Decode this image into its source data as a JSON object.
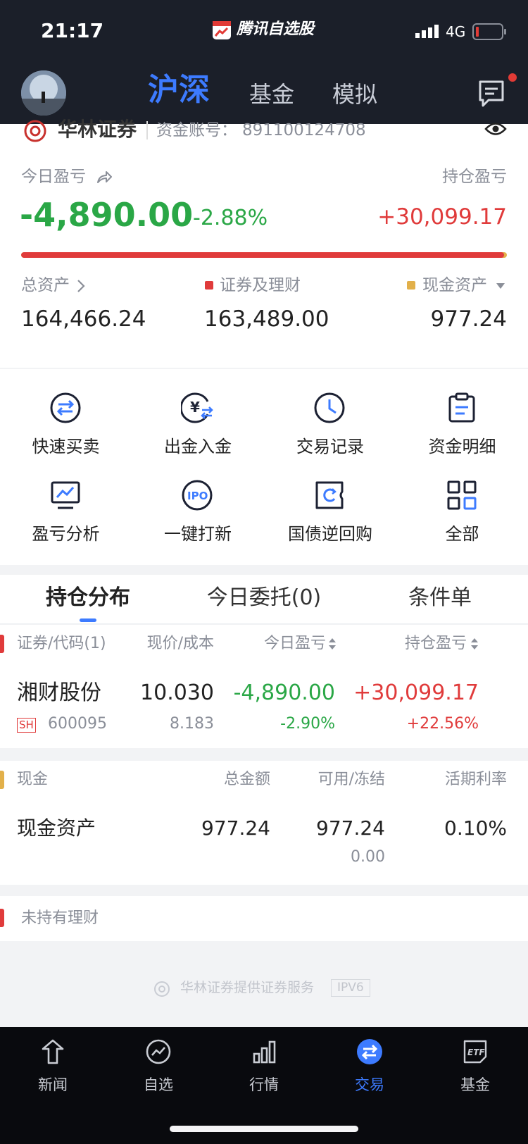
{
  "status_bar": {
    "time": "21:17",
    "app_name": "腾讯自选股",
    "network": "4G"
  },
  "nav": {
    "tabs": [
      "沪深",
      "基金",
      "模拟"
    ],
    "active_tab": 0
  },
  "account": {
    "broker": "华林证券",
    "account_label": "资金账号：",
    "account_number": "891100124708"
  },
  "summary": {
    "today_pl_label": "今日盈亏",
    "today_pl": "-4,890.00",
    "today_pl_pct": "-2.88%",
    "holding_pl_label": "持仓盈亏",
    "holding_pl": "+30,099.17",
    "securities_ratio": 0.994,
    "total_assets_label": "总资产",
    "total_assets": "164,466.24",
    "securities_label": "证券及理财",
    "securities_value": "163,489.00",
    "cash_label": "现金资产",
    "cash_value": "977.24"
  },
  "actions": [
    {
      "label": "快速买卖",
      "icon": "swap-icon"
    },
    {
      "label": "出金入金",
      "icon": "yuan-transfer-icon"
    },
    {
      "label": "交易记录",
      "icon": "clock-icon"
    },
    {
      "label": "资金明细",
      "icon": "clipboard-icon"
    },
    {
      "label": "盈亏分析",
      "icon": "chart-monitor-icon"
    },
    {
      "label": "一键打新",
      "icon": "ipo-icon"
    },
    {
      "label": "国债逆回购",
      "icon": "reverse-repo-icon"
    },
    {
      "label": "全部",
      "icon": "grid-icon"
    }
  ],
  "position_tabs": {
    "tabs": [
      "持仓分布",
      "今日委托(0)",
      "条件单"
    ],
    "active": 0
  },
  "holdings": {
    "headers": [
      "证券/代码(1)",
      "现价/成本",
      "今日盈亏",
      "持仓盈亏"
    ],
    "rows": [
      {
        "name": "湘财股份",
        "market": "SH",
        "code": "600095",
        "price": "10.030",
        "cost": "8.183",
        "today_pl": "-4,890.00",
        "today_pl_pct": "-2.90%",
        "holding_pl": "+30,099.17",
        "holding_pl_pct": "+22.56%"
      }
    ]
  },
  "cash": {
    "headers": [
      "现金",
      "总金额",
      "可用/冻结",
      "活期利率"
    ],
    "row": {
      "name": "现金资产",
      "total": "977.24",
      "available": "977.24",
      "frozen": "0.00",
      "rate": "0.10%"
    }
  },
  "wealth": {
    "label": "未持有理财"
  },
  "footer": {
    "text": "华林证券提供证券服务",
    "badge": "IPV6"
  },
  "bottom_nav": {
    "items": [
      {
        "label": "新闻",
        "icon": "news-icon"
      },
      {
        "label": "自选",
        "icon": "watchlist-icon"
      },
      {
        "label": "行情",
        "icon": "market-icon"
      },
      {
        "label": "交易",
        "icon": "trade-icon"
      },
      {
        "label": "基金",
        "icon": "etf-icon"
      }
    ],
    "active": 3
  },
  "colors": {
    "accent": "#3d7bff",
    "rise": "#e03b3b",
    "fall": "#2aa746",
    "cash": "#e2b04a",
    "dark_bg": "#1b1f29"
  }
}
